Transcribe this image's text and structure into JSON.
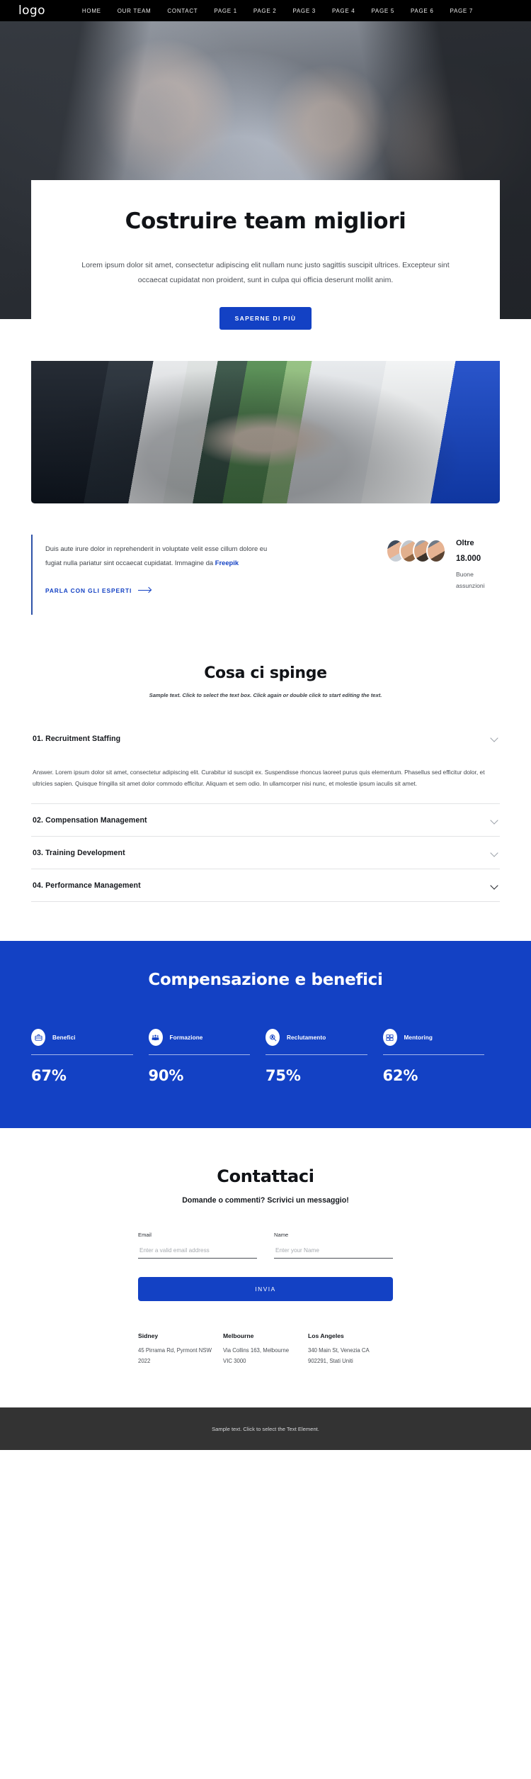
{
  "nav": {
    "logo": "logo",
    "links": [
      "HOME",
      "OUR TEAM",
      "CONTACT",
      "PAGE 1",
      "PAGE 2",
      "PAGE 3",
      "PAGE 4",
      "PAGE 5",
      "PAGE 6",
      "PAGE 7"
    ]
  },
  "hero": {
    "title": "Costruire team migliori",
    "paragraph": "Lorem ipsum dolor sit amet, consectetur adipiscing elit nullam nunc justo sagittis suscipit ultrices. Excepteur sint occaecat cupidatat non proident, sunt in culpa qui officia deserunt mollit anim.",
    "cta": "SAPERNE DI PIÙ"
  },
  "quote": {
    "text_before": "Duis aute irure dolor in reprehenderit in voluptate velit esse cillum dolore eu fugiat nulla pariatur sint occaecat cupidatat. Immagine da ",
    "link_text": "Freepik",
    "cta": "PARLA CON GLI ESPERTI"
  },
  "stat": {
    "line1": "Oltre",
    "line2": "18.000",
    "line3": "Buone assunzioni"
  },
  "accordion_section": {
    "title": "Cosa ci spinge",
    "subtitle": "Sample text. Click to select the text box. Click again or double click to start editing the text.",
    "items": [
      {
        "title": "01. Recruitment Staffing",
        "body": "Answer. Lorem ipsum dolor sit amet, consectetur adipiscing elit. Curabitur id suscipit ex. Suspendisse rhoncus laoreet purus quis elementum. Phasellus sed efficitur dolor, et ultricies sapien. Quisque fringilla sit amet dolor commodo efficitur. Aliquam et sem odio. In ullamcorper nisi nunc, et molestie ipsum iaculis sit amet.",
        "open": true
      },
      {
        "title": "02. Compensation Management",
        "body": "",
        "open": false
      },
      {
        "title": "03. Training Development",
        "body": "",
        "open": false
      },
      {
        "title": "04. Performance Management",
        "body": "",
        "open": false
      }
    ]
  },
  "blue_section": {
    "title": "Compensazione e benefici",
    "background": "#1341c4",
    "stats": [
      {
        "icon": "briefcase-icon",
        "label": "Benefici",
        "value": "67%"
      },
      {
        "icon": "people-group-icon",
        "label": "Formazione",
        "value": "90%"
      },
      {
        "icon": "magnifier-person-icon",
        "label": "Reclutamento",
        "value": "75%"
      },
      {
        "icon": "id-card-icon",
        "label": "Mentoring",
        "value": "62%"
      }
    ]
  },
  "contact": {
    "title": "Contattaci",
    "subtitle": "Domande o commenti? Scrivici un messaggio!",
    "email_label": "Email",
    "email_placeholder": "Enter a valid email address",
    "email_value": "",
    "name_label": "Name",
    "name_placeholder": "Enter your Name",
    "name_value": "",
    "submit": "INVIA"
  },
  "offices": [
    {
      "city": "Sidney",
      "address": "45 Pirrama Rd, Pyrmont NSW 2022"
    },
    {
      "city": "Melbourne",
      "address": "Via Collins 163, Melbourne VIC 3000"
    },
    {
      "city": "Los Angeles",
      "address": "340 Main St, Venezia CA 902291, Stati Uniti"
    }
  ],
  "footer": {
    "text": "Sample text. Click to select the Text Element."
  },
  "colors": {
    "accent": "#1341c4",
    "nav_bg": "#000000",
    "footer_bg": "#333333"
  }
}
